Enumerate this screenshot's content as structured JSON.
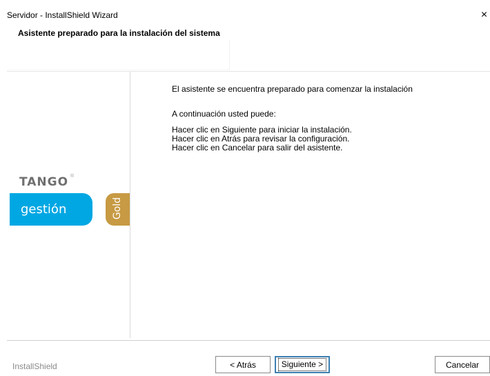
{
  "window": {
    "title": "Servidor - InstallShield Wizard",
    "close_glyph": "×"
  },
  "header": {
    "title": "Asistente preparado para la instalación del sistema"
  },
  "branding": {
    "logo_text": "TANGO",
    "logo_mark": "®",
    "product": "gestión",
    "edition": "Gold",
    "colors": {
      "product_blue": "#00a7e3",
      "gold": "#c79a43",
      "logo_gray": "#6f6f6f"
    }
  },
  "body": {
    "intro": "El asistente se encuentra preparado para comenzar la instalación",
    "subhead": "A continuación usted puede:",
    "instructions": [
      "Hacer clic en Siguiente para iniciar la instalación.",
      "Hacer clic en Atrás para revisar la configuración.",
      "Hacer clic en Cancelar para salir del asistente."
    ]
  },
  "footer": {
    "brand": "InstallShield",
    "back_label": "< Atrás",
    "next_label": "Siguiente >",
    "cancel_label": "Cancelar"
  }
}
